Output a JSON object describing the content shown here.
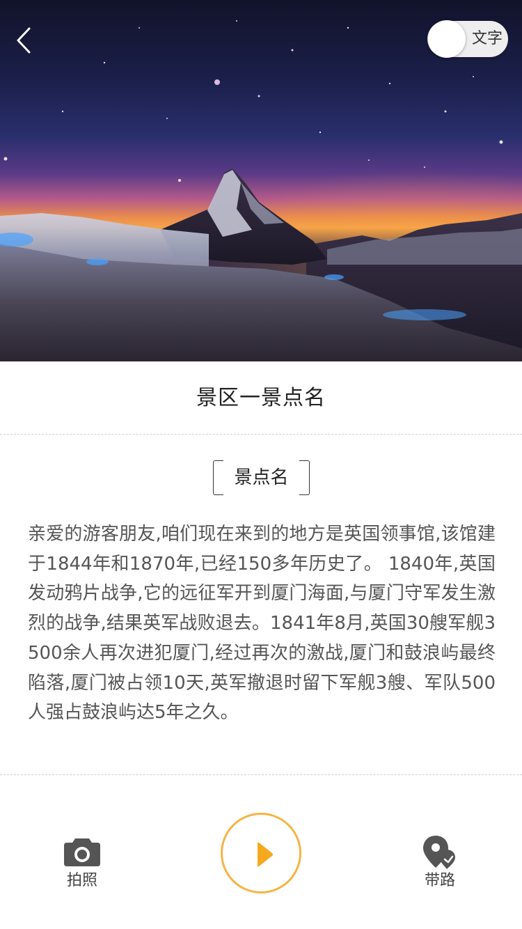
{
  "hero": {
    "image_subject": "mountain-peak-under-starry-night-sky",
    "back_icon": "chevron-left-icon",
    "text_toggle": {
      "label": "文字",
      "state": "off"
    }
  },
  "title": "景区一景点名",
  "spot": {
    "name": "景点名",
    "description": "亲爱的游客朋友,咱们现在来到的地方是英国领事馆,该馆建于1844年和1870年,已经150多年历史了。 1840年,英国发动鸦片战争,它的远征军开到厦门海面,与厦门守军发生激烈的战争,结果英军战败退去。1841年8月,英国30艘军舰3500余人再次进犯厦门,经过再次的激战,厦门和鼓浪屿最终陷落,厦门被占领10天,英军撤退时留下军舰3艘、军队500人强占鼓浪屿达5年之久。"
  },
  "bottom_bar": {
    "camera": {
      "label": "拍照",
      "icon": "camera-icon"
    },
    "play": {
      "icon": "play-icon"
    },
    "route": {
      "label": "带路",
      "icon": "location-pin-icon"
    }
  },
  "colors": {
    "accent": "#f6b443",
    "icon_dark": "#555555",
    "text": "#555555"
  }
}
